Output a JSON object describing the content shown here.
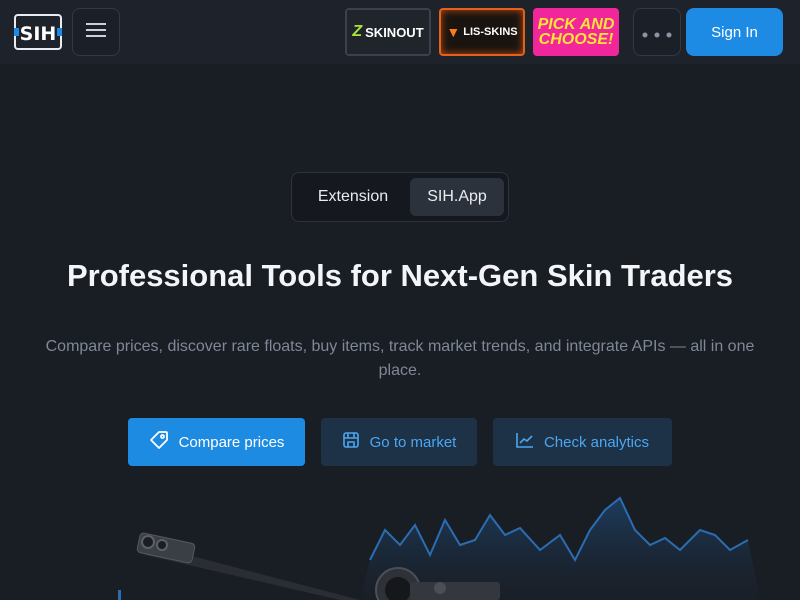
{
  "header": {
    "logo_text": "SIH",
    "menu_icon": "hamburger-icon",
    "banners": [
      {
        "label": "SKINOUT",
        "icon": "z-logo-icon"
      },
      {
        "label": "LIS-SKINS",
        "icon": "fox-icon"
      },
      {
        "line1": "PICK AND",
        "line2": "CHOOSE!"
      }
    ],
    "more_icon": "more-dots-icon",
    "signin_label": "Sign In"
  },
  "tabs": [
    {
      "label": "Extension",
      "active": false
    },
    {
      "label": "SIH.App",
      "active": true
    }
  ],
  "hero": {
    "title": "Professional Tools for Next-Gen Skin Traders",
    "subtitle": "Compare prices, discover rare floats, buy items, track market trends, and integrate APIs — all in one place."
  },
  "actions": {
    "compare_label": "Compare prices",
    "market_label": "Go to market",
    "analytics_label": "Check analytics"
  },
  "colors": {
    "accent": "#1d8be4",
    "background": "#191d24",
    "secondary_button": "#1d3147",
    "secondary_text": "#4ba7f1"
  }
}
